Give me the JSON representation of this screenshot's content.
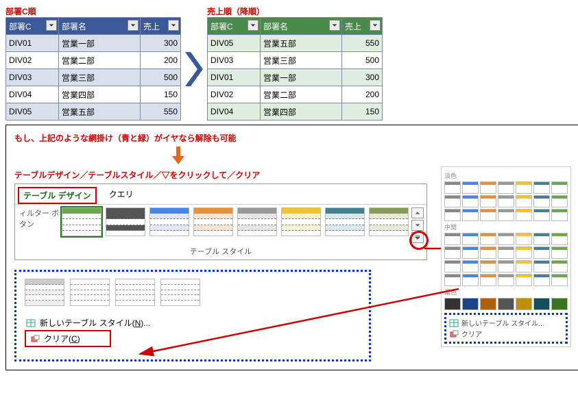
{
  "left_table": {
    "title": "部署C順",
    "headers": [
      "部署C",
      "部署名",
      "売上"
    ],
    "rows": [
      {
        "c": "DIV01",
        "n": "営業一部",
        "s": 300
      },
      {
        "c": "DIV02",
        "n": "営業二部",
        "s": 200
      },
      {
        "c": "DIV03",
        "n": "営業三部",
        "s": 500
      },
      {
        "c": "DIV04",
        "n": "営業四部",
        "s": 150
      },
      {
        "c": "DIV05",
        "n": "営業五部",
        "s": 550
      }
    ]
  },
  "right_table": {
    "title": "売上順（降順）",
    "headers": [
      "部署C",
      "部署名",
      "売上"
    ],
    "rows": [
      {
        "c": "DIV05",
        "n": "営業五部",
        "s": 550
      },
      {
        "c": "DIV03",
        "n": "営業三部",
        "s": 500
      },
      {
        "c": "DIV01",
        "n": "営業一部",
        "s": 300
      },
      {
        "c": "DIV02",
        "n": "営業二部",
        "s": 200
      },
      {
        "c": "DIV04",
        "n": "営業四部",
        "s": 150
      }
    ]
  },
  "panel": {
    "note1": "もし、上記のような網掛け（青と緑）がイヤなら解除も可能",
    "note2": "テーブルデザイン／テーブルスタイル／▽をクリックして／クリア",
    "tab_active": "テーブル デザイン",
    "tab_other": "クエリ",
    "ribbon_left_label": "ィルター ボタン",
    "styles_group_label": "テーブル スタイル",
    "gallery_sections": {
      "light": "淡色",
      "medium": "中間",
      "dark": "濃色"
    },
    "gallery_footer": {
      "new_style": "新しいテーブル スタイル...",
      "clear": "クリア"
    },
    "menu": {
      "new_style": "新しいテーブル スタイル(N)...",
      "clear": "クリア(C)"
    }
  },
  "style_thumbs": [
    {
      "name": "light-green",
      "head": "#6aa84f",
      "body": "#ffffff",
      "sel": true
    },
    {
      "name": "dark-grey",
      "head": "#555555",
      "body": "#555555"
    },
    {
      "name": "blue",
      "head": "#4a86e8",
      "body": "#dfe8f6"
    },
    {
      "name": "orange",
      "head": "#e69138",
      "body": "#f9e4cf"
    },
    {
      "name": "grey",
      "head": "#999999",
      "body": "#e6e6e6"
    },
    {
      "name": "yellow",
      "head": "#f1c232",
      "body": "#fbf2d0"
    },
    {
      "name": "teal",
      "head": "#45818e",
      "body": "#d9e8ea"
    },
    {
      "name": "olive",
      "head": "#8a9a5b",
      "body": "#e7ebd6"
    }
  ],
  "chart_data": [
    {
      "type": "table",
      "title": "部署C順",
      "columns": [
        "部署C",
        "部署名",
        "売上"
      ],
      "rows": [
        [
          "DIV01",
          "営業一部",
          300
        ],
        [
          "DIV02",
          "営業二部",
          200
        ],
        [
          "DIV03",
          "営業三部",
          500
        ],
        [
          "DIV04",
          "営業四部",
          150
        ],
        [
          "DIV05",
          "営業五部",
          550
        ]
      ]
    },
    {
      "type": "table",
      "title": "売上順（降順）",
      "columns": [
        "部署C",
        "部署名",
        "売上"
      ],
      "rows": [
        [
          "DIV05",
          "営業五部",
          550
        ],
        [
          "DIV03",
          "営業三部",
          500
        ],
        [
          "DIV01",
          "営業一部",
          300
        ],
        [
          "DIV02",
          "営業二部",
          200
        ],
        [
          "DIV04",
          "営業四部",
          150
        ]
      ]
    }
  ]
}
